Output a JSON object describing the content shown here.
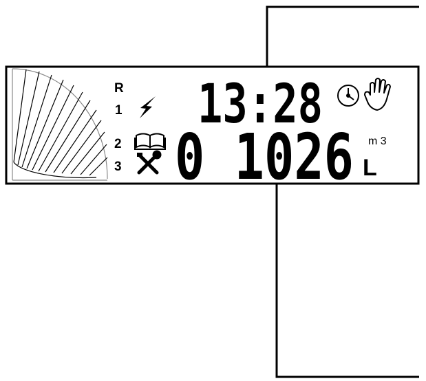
{
  "display": {
    "row_labels": {
      "r": "R",
      "one": "1",
      "two": "2",
      "three": "3"
    },
    "time": "13:28",
    "volume": "0 1026",
    "unit_m3": "m 3",
    "unit_l": "L",
    "icons": [
      "lightning-icon",
      "book-icon",
      "tools-icon",
      "clock-icon",
      "hand-icon",
      "fan-segment-icon"
    ]
  }
}
